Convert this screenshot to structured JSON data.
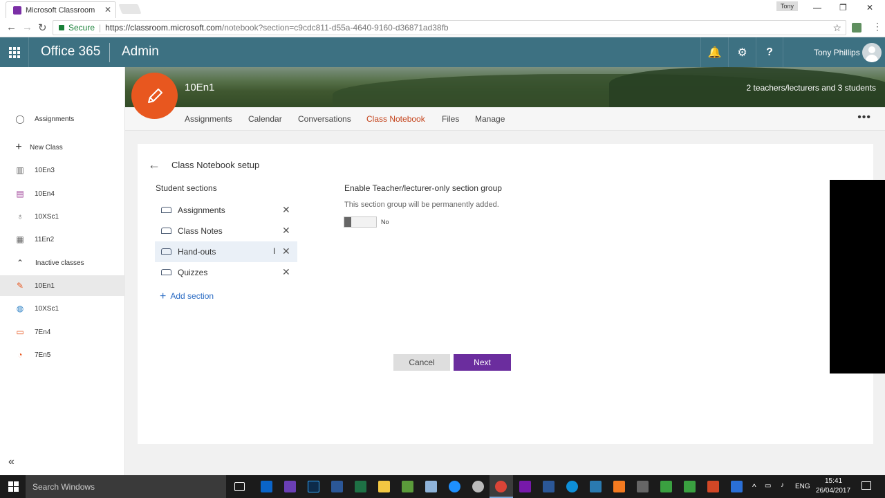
{
  "browser": {
    "tab_title": "Microsoft Classroom",
    "tab_close": "✕",
    "profile_chip": "Tony",
    "secure_label": "Secure",
    "url_main": "https://classroom.microsoft.com",
    "url_rest": "/notebook?section=c9cdc811-d55a-4640-9160-d36871ad38fb"
  },
  "topbar": {
    "brand": "Office 365",
    "app_title": "Admin",
    "user_name": "Tony Phillips",
    "bell_icon": "🔔",
    "gear_icon": "⚙",
    "help_icon": "?"
  },
  "sidebar": {
    "items": [
      {
        "label": "Assignments",
        "icon": "lightbulb-icon",
        "glyph": "◯"
      },
      {
        "label": "New Class",
        "icon": "plus-icon",
        "glyph": "+"
      },
      {
        "label": "10En3",
        "icon": "books-icon",
        "glyph": "▥"
      },
      {
        "label": "10En4",
        "icon": "briefcase-icon",
        "glyph": "▤"
      },
      {
        "label": "10XSc1",
        "icon": "stethoscope-icon",
        "glyph": "♁"
      },
      {
        "label": "11En2",
        "icon": "calculator-icon",
        "glyph": "▦"
      },
      {
        "label": "Inactive classes",
        "icon": "chevron-up-icon",
        "glyph": "⌃"
      },
      {
        "label": "10En1",
        "icon": "pencil-icon",
        "glyph": "✎"
      },
      {
        "label": "10XSc1",
        "icon": "globe-icon",
        "glyph": "◍"
      },
      {
        "label": "7En4",
        "icon": "keyboard-icon",
        "glyph": "▭"
      },
      {
        "label": "7En5",
        "icon": "pie-icon",
        "glyph": "◔"
      }
    ],
    "collapse_glyph": "«"
  },
  "classheader": {
    "name": "10En1",
    "members": "2 teachers/lecturers and 3 students",
    "accent": "#e8571f"
  },
  "tabs": [
    "Assignments",
    "Calendar",
    "Conversations",
    "Class Notebook",
    "Files",
    "Manage"
  ],
  "more_glyph": "•••",
  "setup": {
    "back_glyph": "←",
    "title": "Class Notebook setup",
    "student_sections_title": "Student sections",
    "sections": [
      "Assignments",
      "Class Notes",
      "Hand-outs",
      "Quizzes"
    ],
    "remove_glyph": "✕",
    "add_section": "Add section",
    "teacher_group_title": "Enable Teacher/lecturer-only section group",
    "teacher_group_desc": "This section group will be permanently added.",
    "toggle_state": "No",
    "cancel": "Cancel",
    "next": "Next"
  },
  "colors": {
    "o365_bar": "#3d7182",
    "active_tab": "#c4421a",
    "next_button": "#6b2d9e",
    "link": "#2b6cc4"
  },
  "taskbar": {
    "search_placeholder": "Search Windows",
    "language": "ENG",
    "time": "15:41",
    "date": "26/04/2017"
  }
}
